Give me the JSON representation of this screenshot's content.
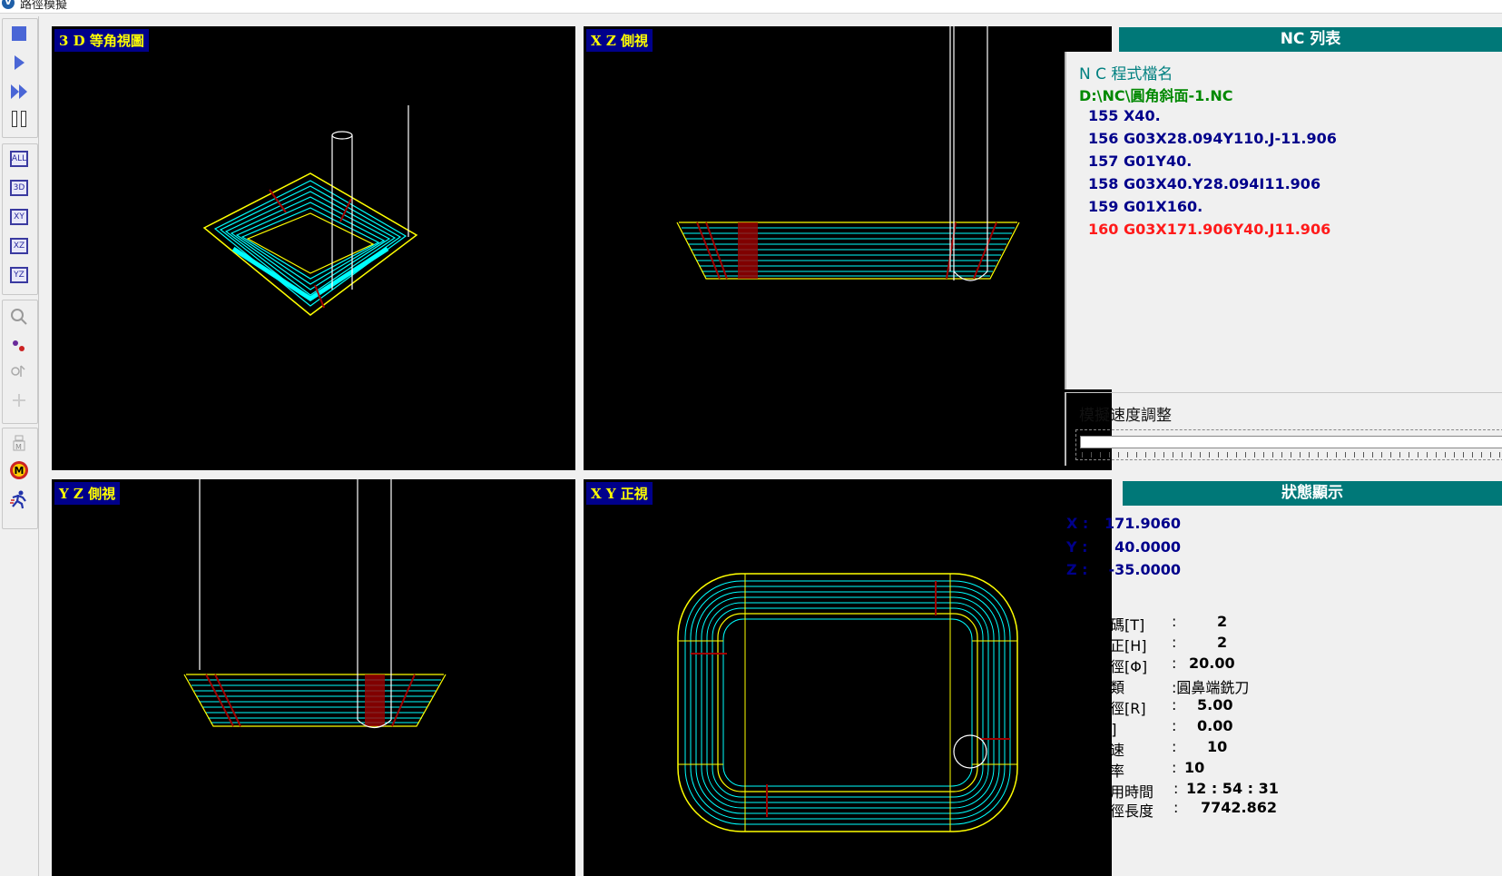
{
  "window": {
    "title": "路徑模擬"
  },
  "toolbar": {
    "view_buttons": [
      "ALL",
      "3D",
      "XY",
      "XZ",
      "YZ"
    ]
  },
  "views": {
    "iso": {
      "label": "3 D 等角視圖"
    },
    "xz": {
      "label": "X Z 側視"
    },
    "yz": {
      "label": "Y Z 側視"
    },
    "xy": {
      "label": "X Y 正視"
    }
  },
  "nc_list": {
    "title": "NC 列表",
    "file_label": "N C 程式檔名",
    "file_path": "D:\\NC\\圓角斜面-1.NC",
    "lines": [
      "155 X40.",
      "156 G03X28.094Y110.J-11.906",
      "157 G01Y40.",
      "158 G03X40.Y28.094I11.906",
      "159 G01X160.",
      "160 G03X171.906Y40.J11.906"
    ],
    "current_line_color": "#ff1a1a"
  },
  "speed": {
    "label": "模擬速度調整"
  },
  "status": {
    "title": "狀態顯示",
    "coords": [
      {
        "key": "X :",
        "value": "171.9060"
      },
      {
        "key": "Y :",
        "value": "40.0000"
      },
      {
        "key": "Z :",
        "value": "-35.0000"
      }
    ],
    "params": [
      {
        "key": "刀盤號碼[T]",
        "value": "2"
      },
      {
        "key": "刀長補正[H]",
        "value": "2"
      },
      {
        "key": "刀具直徑[Φ]",
        "value": "20.00"
      },
      {
        "key": "刀具種類",
        "value": ":圓鼻端銑刀"
      },
      {
        "key": "圓鼻半徑[R]",
        "value": "5.00"
      },
      {
        "key": "錐度[A]",
        "value": "0.00"
      },
      {
        "key": "主軸轉速",
        "value": "10"
      },
      {
        "key": "進給速率",
        "value": "10"
      },
      {
        "key": "加工已用時間",
        "value": "12 : 54 : 31"
      },
      {
        "key": "切削路徑長度",
        "value": "7742.862"
      }
    ]
  },
  "colors": {
    "panel_header": "#007878",
    "view_bg": "#000000",
    "path_cyan": "#00ffff",
    "path_yellow": "#ffff00",
    "path_red": "#a00000",
    "nc_text": "#00008b",
    "nc_file": "#008800"
  }
}
